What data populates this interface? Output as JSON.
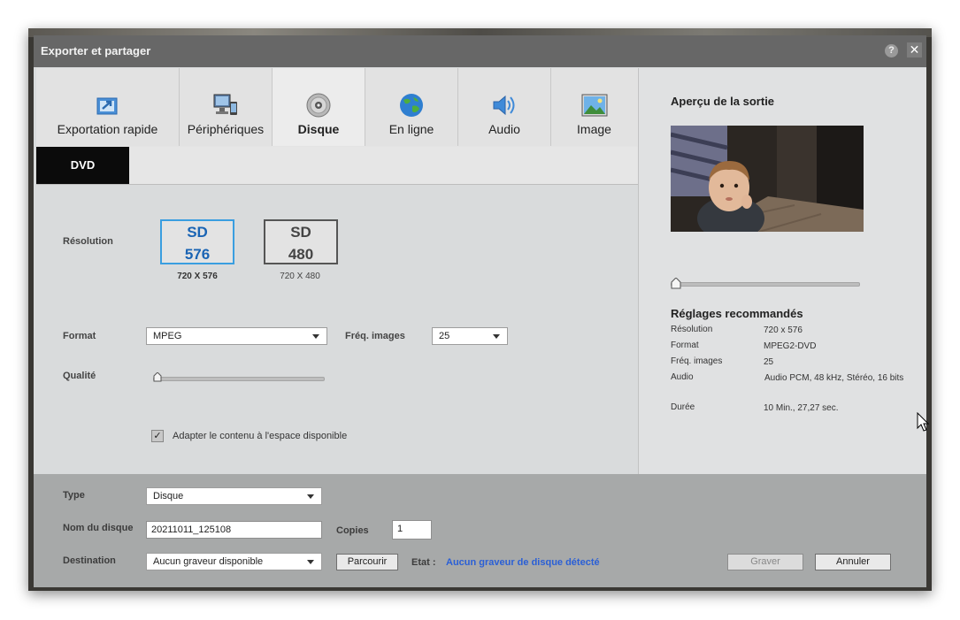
{
  "window": {
    "title": "Exporter et partager",
    "help": "?",
    "close": "✕"
  },
  "tabs": [
    {
      "label": "Exportation rapide",
      "icon": "quick-export-icon"
    },
    {
      "label": "Périphériques",
      "icon": "devices-icon"
    },
    {
      "label": "Disque",
      "icon": "disc-icon"
    },
    {
      "label": "En ligne",
      "icon": "globe-icon"
    },
    {
      "label": "Audio",
      "icon": "speaker-icon"
    },
    {
      "label": "Image",
      "icon": "image-icon"
    }
  ],
  "subtab": {
    "label": "DVD"
  },
  "settings": {
    "resolution_label": "Résolution",
    "sd576": {
      "line1": "SD",
      "line2": "576",
      "caption": "720 X 576"
    },
    "sd480": {
      "line1": "SD",
      "line2": "480",
      "caption": "720 X 480"
    },
    "format_label": "Format",
    "format_value": "MPEG",
    "fps_label": "Fréq. images",
    "fps_value": "25",
    "quality_label": "Qualité",
    "quality_level": 0,
    "fit_label": "Adapter le contenu à l'espace disponible",
    "fit_checked": "✓"
  },
  "preview": {
    "title": "Aperçu de la sortie",
    "position": 0,
    "recommended_title": "Réglages recommandés",
    "rows": [
      {
        "key": "Résolution",
        "value": "720 x 576"
      },
      {
        "key": "Format",
        "value": "MPEG2-DVD"
      },
      {
        "key": "Fréq. images",
        "value": "25"
      },
      {
        "key": "Audio",
        "value": "Audio PCM, 48  kHz, Stéréo, 16 bits"
      },
      {
        "key": "Durée",
        "value": "10 Min., 27,27 sec."
      }
    ]
  },
  "bottom": {
    "type_label": "Type",
    "type_value": "Disque",
    "disc_name_label": "Nom du disque",
    "disc_name_value": "20211011_125108",
    "copies_label": "Copies",
    "copies_value": "1",
    "destination_label": "Destination",
    "destination_value": "Aucun graveur disponible",
    "browse": "Parcourir",
    "state_label": "Etat :",
    "state_value": "Aucun graveur de disque détecté",
    "burn": "Graver",
    "cancel": "Annuler"
  },
  "colors": {
    "accent": "#3a9ee0",
    "status": "#2a5fd6",
    "titlebar": "#676767"
  }
}
